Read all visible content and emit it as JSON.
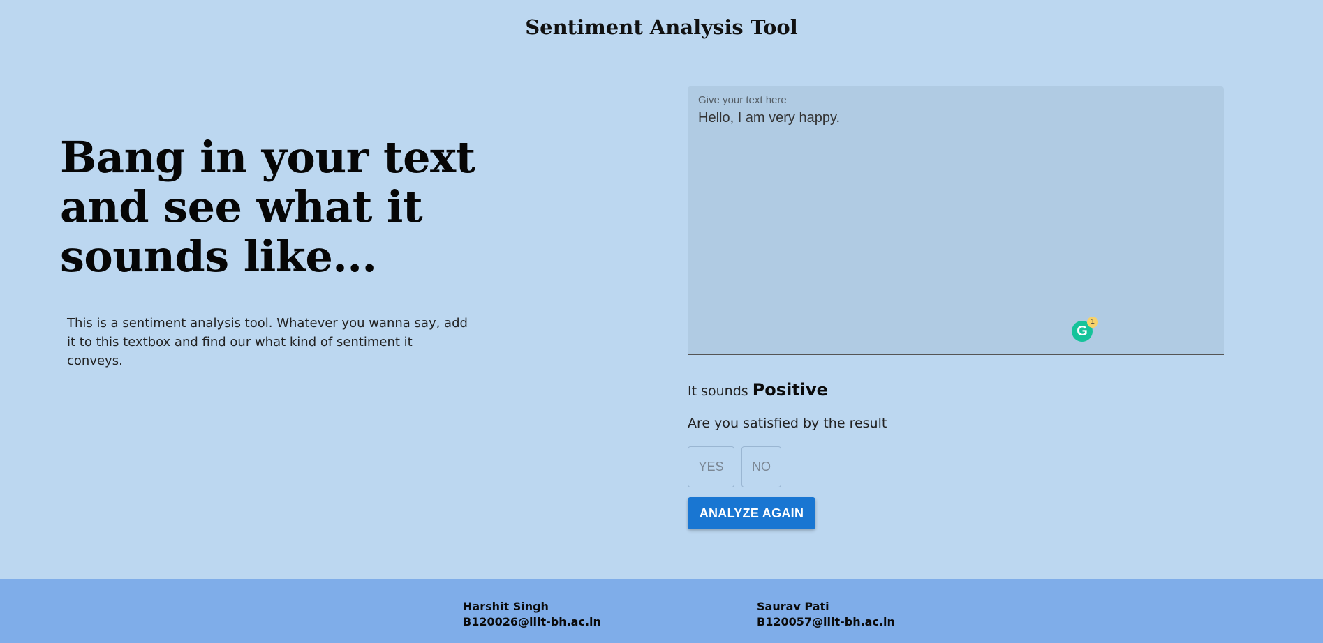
{
  "header": {
    "title": "Sentiment Analysis Tool"
  },
  "hero": {
    "headline": "Bang in your text and see what it sounds like...",
    "description": "This is a sentiment analysis tool. Whatever you wanna say, add it to this textbox and find our what kind of sentiment it conveys."
  },
  "input": {
    "label": "Give your text here",
    "value": "Hello, I am very happy.",
    "grammarly_icon_letter": "G",
    "grammarly_badge_count": "1"
  },
  "result": {
    "prefix": "It sounds",
    "sentiment": "Positive",
    "question": "Are you satisfied by the result",
    "yes_label": "YES",
    "no_label": "NO",
    "analyze_again_label": "ANALYZE AGAIN"
  },
  "footer": {
    "contacts": [
      {
        "name": "Harshit Singh",
        "email": "B120026@iiit-bh.ac.in"
      },
      {
        "name": "Saurav Pati",
        "email": "B120057@iiit-bh.ac.in"
      }
    ]
  },
  "colors": {
    "background": "#bcd7f0",
    "textfield": "#b0cbe3",
    "primary": "#1976d2",
    "footer": "#7fade9",
    "grammarly": "#15c39a"
  }
}
